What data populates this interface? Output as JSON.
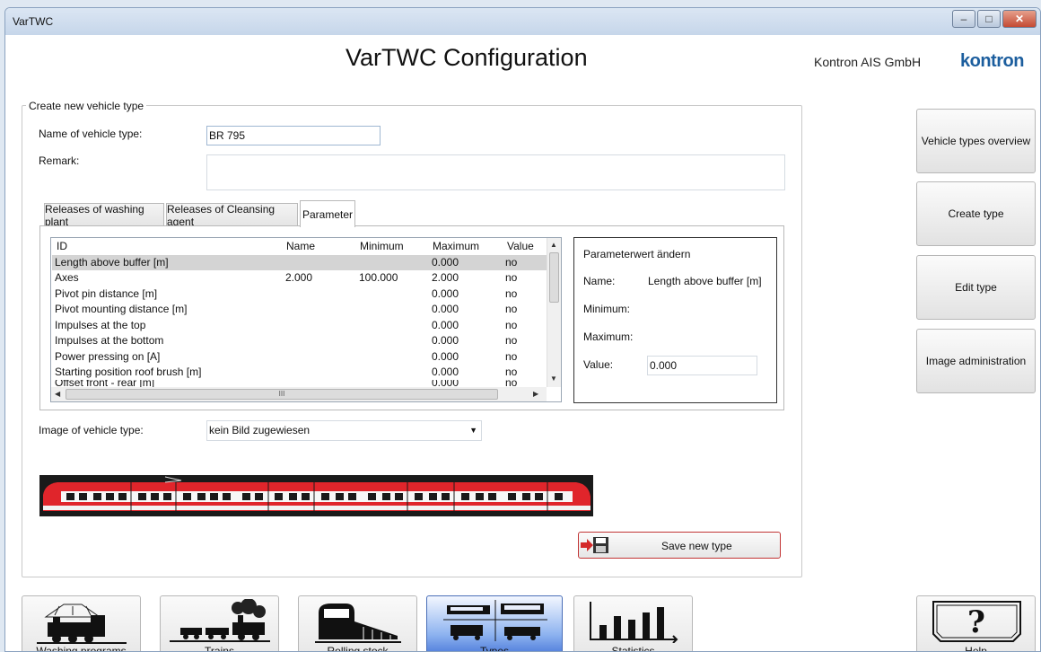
{
  "window": {
    "title": "VarTWC",
    "minimize_glyph": "‒",
    "maximize_glyph": "□",
    "close_glyph": "✕"
  },
  "header": {
    "title": "VarTWC Configuration",
    "company": "Kontron AIS GmbH",
    "brand": "kontron"
  },
  "form": {
    "group_title": "Create new vehicle type",
    "name_label": "Name of vehicle type:",
    "name_value": "BR 795",
    "remark_label": "Remark:",
    "remark_value": "",
    "image_label": "Image of vehicle type:",
    "image_select_value": "kein Bild zugewiesen",
    "save_label": "Save new type"
  },
  "tabs": [
    {
      "label": "Releases of washing plant",
      "active": false
    },
    {
      "label": "Releases of Cleansing agent",
      "active": false
    },
    {
      "label": "Parameter",
      "active": true
    }
  ],
  "grid": {
    "columns": [
      "ID",
      "Name",
      "Minimum",
      "Maximum",
      "Value"
    ],
    "rows": [
      {
        "id": "Length above buffer [m]",
        "name": "",
        "min": "",
        "max": "0.000",
        "value": "no",
        "selected": true
      },
      {
        "id": "Axes",
        "name": "2.000",
        "min": "100.000",
        "max": "2.000",
        "value": "no"
      },
      {
        "id": "Pivot pin distance [m]",
        "name": "",
        "min": "",
        "max": "0.000",
        "value": "no"
      },
      {
        "id": "Pivot mounting distance [m]",
        "name": "",
        "min": "",
        "max": "0.000",
        "value": "no"
      },
      {
        "id": "Impulses at the top",
        "name": "",
        "min": "",
        "max": "0.000",
        "value": "no"
      },
      {
        "id": "Impulses at the bottom",
        "name": "",
        "min": "",
        "max": "0.000",
        "value": "no"
      },
      {
        "id": "Power pressing on [A]",
        "name": "",
        "min": "",
        "max": "0.000",
        "value": "no"
      },
      {
        "id": "Starting position roof brush [m]",
        "name": "",
        "min": "",
        "max": "0.000",
        "value": "no"
      },
      {
        "id": "Offset front - rear [m]",
        "name": "",
        "min": "",
        "max": "0.000",
        "value": "no"
      }
    ],
    "hscroll_glyph": "III"
  },
  "param_edit": {
    "title": "Parameterwert ändern",
    "name_label": "Name:",
    "name_value": "Length above buffer [m]",
    "min_label": "Minimum:",
    "max_label": "Maximum:",
    "value_label": "Value:",
    "value": "0.000"
  },
  "side_buttons": [
    {
      "label": "Vehicle types overview"
    },
    {
      "label": "Create type"
    },
    {
      "label": "Edit type"
    },
    {
      "label": "Image administration"
    }
  ],
  "bottom_nav": [
    {
      "label": "Washing programs",
      "icon": "washing-locomotive-icon"
    },
    {
      "label": "Trains",
      "icon": "steam-train-icon"
    },
    {
      "label": "Rolling stock",
      "icon": "rolling-stock-icon"
    },
    {
      "label": "Types",
      "icon": "vehicle-types-icon",
      "active": true
    },
    {
      "label": "Statistics",
      "icon": "bar-chart-icon"
    },
    {
      "label": "Help",
      "icon": "help-icon"
    }
  ],
  "colors": {
    "accent": "#1c5e9e",
    "save_border": "#c23535",
    "train_red": "#e0252b"
  }
}
